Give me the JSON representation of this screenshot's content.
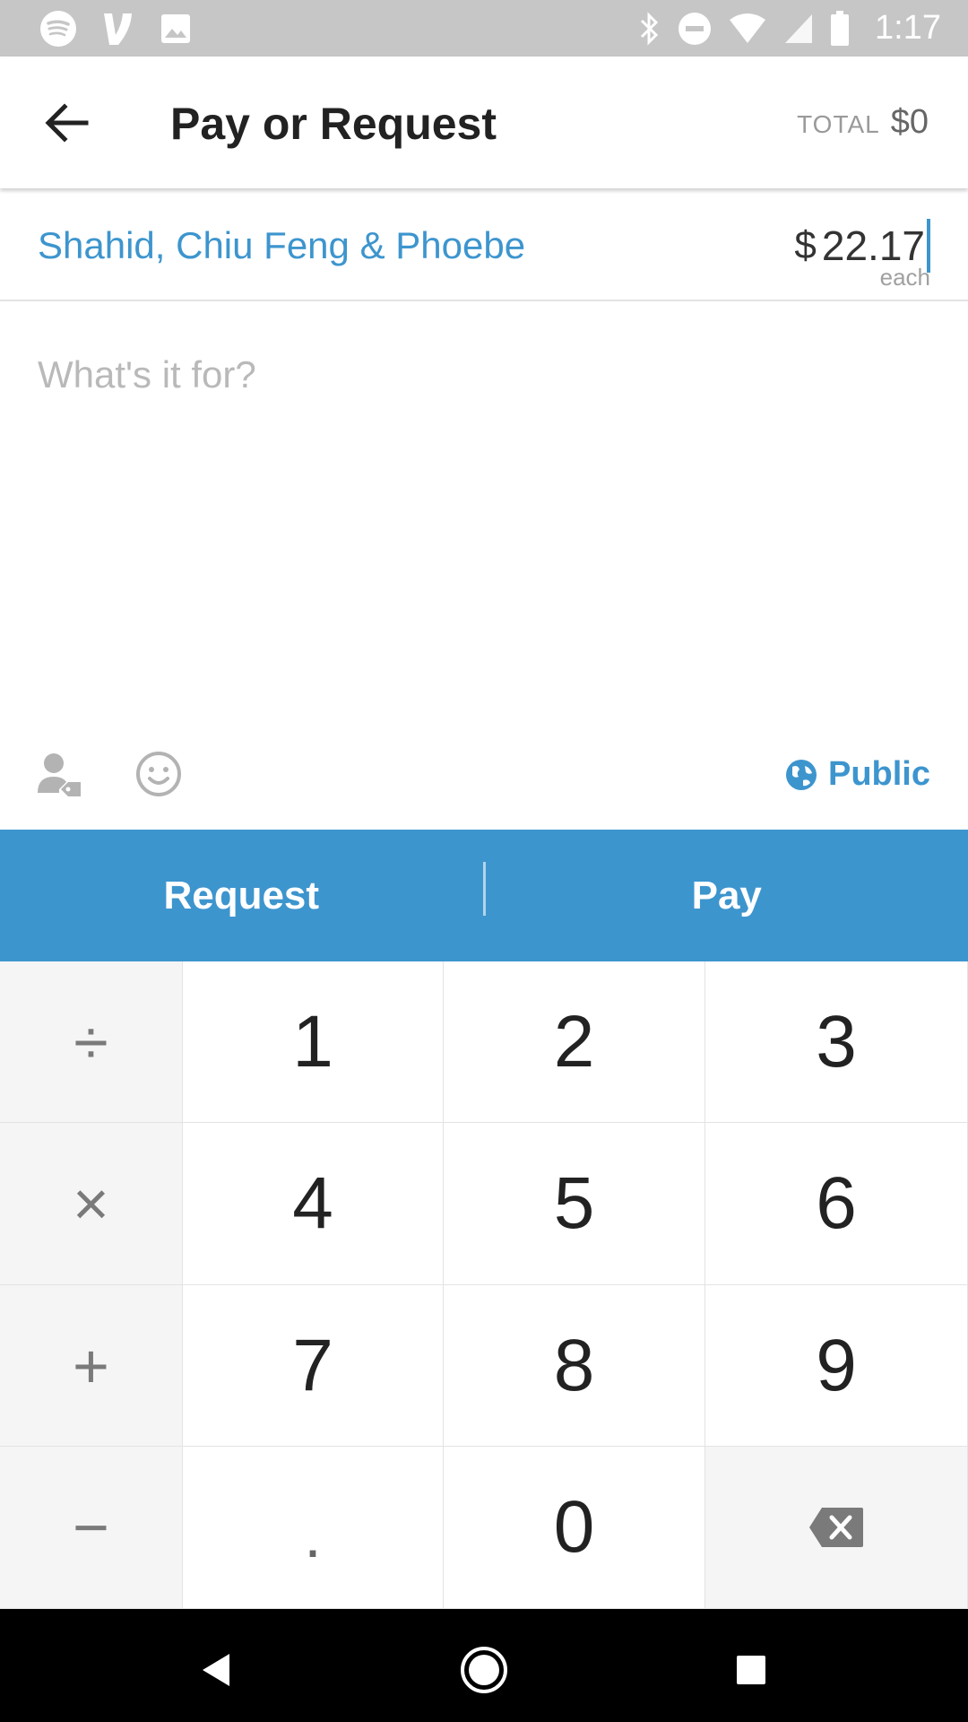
{
  "status_bar": {
    "time": "1:17",
    "left_icons": [
      "spotify-icon",
      "venmo-icon",
      "image-icon"
    ],
    "right_icons": [
      "bluetooth-icon",
      "do-not-disturb-icon",
      "wifi-icon",
      "signal-icon",
      "battery-icon"
    ]
  },
  "header": {
    "title": "Pay or Request",
    "total_label": "TOTAL",
    "total_value": "$0"
  },
  "recipient": {
    "names": "Shahid, Chiu Feng & Phoebe",
    "currency": "$",
    "amount": "22.17",
    "each_label": "each"
  },
  "note": {
    "placeholder": "What's it for?",
    "value": ""
  },
  "tools": {
    "privacy_label": "Public"
  },
  "actions": {
    "request_label": "Request",
    "pay_label": "Pay"
  },
  "keypad": {
    "keys": [
      "÷",
      "1",
      "2",
      "3",
      "×",
      "4",
      "5",
      "6",
      "+",
      "7",
      "8",
      "9",
      "−",
      ".",
      "0",
      "backspace"
    ]
  },
  "colors": {
    "accent": "#3d95ce",
    "statusbar": "#c6c6c6",
    "keypad_op_bg": "#f5f5f5"
  }
}
